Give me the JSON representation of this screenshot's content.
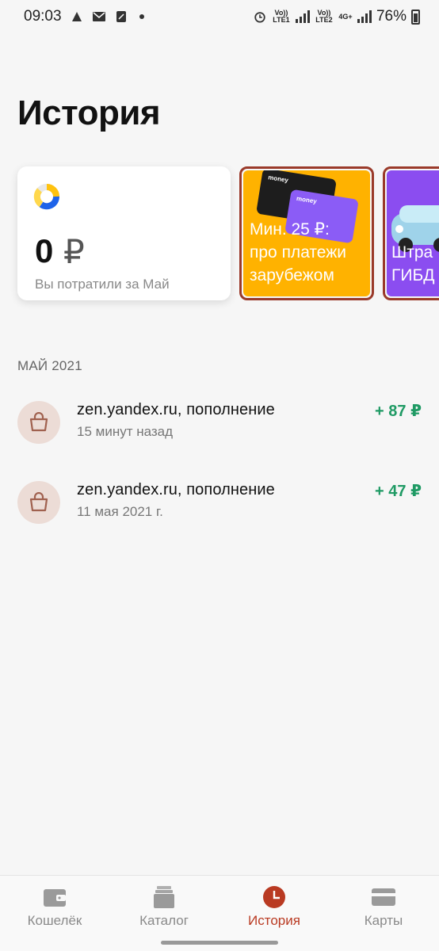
{
  "status_bar": {
    "time": "09:03",
    "net1": "Vo)) LTE1",
    "net2": "Vo)) LTE2",
    "net3": "4G+",
    "battery": "76%"
  },
  "page": {
    "title": "История"
  },
  "spend_card": {
    "amount": "0",
    "currency": "₽",
    "label": "Вы потратили за Май"
  },
  "promos": [
    {
      "text_line1": "Мин. 25 ₽:",
      "text_line2": "про платежи",
      "text_line3": "зарубежом",
      "card_logo": "money"
    },
    {
      "text_line1": "Штра",
      "text_line2": "ГИБД"
    }
  ],
  "section": {
    "month": "МАЙ 2021"
  },
  "transactions": [
    {
      "title": "zen.yandex.ru, пополнение",
      "subtitle": "15 минут назад",
      "amount": "+ 87 ₽"
    },
    {
      "title": "zen.yandex.ru, пополнение",
      "subtitle": "11 мая 2021 г.",
      "amount": "+ 47 ₽"
    }
  ],
  "nav": {
    "items": [
      {
        "label": "Кошелёк"
      },
      {
        "label": "Каталог"
      },
      {
        "label": "История"
      },
      {
        "label": "Карты"
      }
    ],
    "active": "История"
  },
  "colors": {
    "accent": "#b93a22",
    "income": "#1f9a64",
    "promo_yellow": "#ffb200",
    "promo_purple": "#8b4df0"
  }
}
